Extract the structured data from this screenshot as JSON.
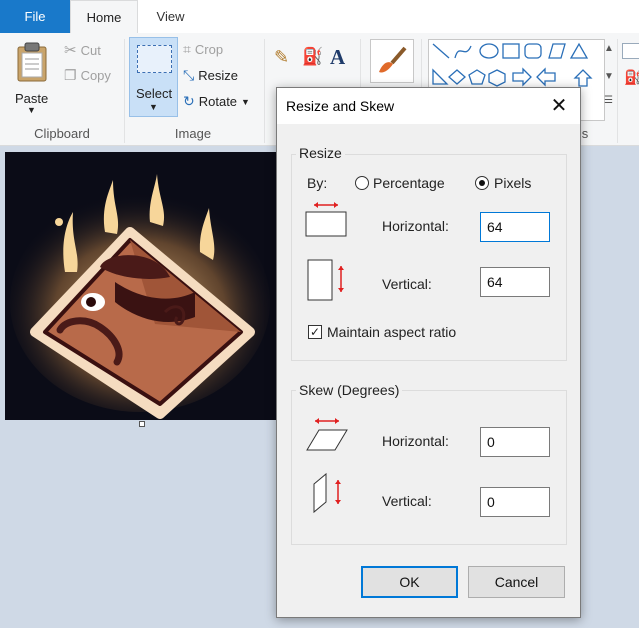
{
  "tabs": {
    "file": "File",
    "home": "Home",
    "view": "View"
  },
  "ribbon": {
    "paste": "Paste",
    "cut": "Cut",
    "copy": "Copy",
    "clipboard_group": "Clipboard",
    "select": "Select",
    "crop": "Crop",
    "resize": "Resize",
    "rotate": "Rotate",
    "image_group": "Image",
    "brushes_letter": "A",
    "shapes_group_partial": "s"
  },
  "dialog": {
    "title": "Resize and Skew",
    "close": "✕",
    "resize_section": "Resize",
    "by_label": "By:",
    "percentage": "Percentage",
    "pixels": "Pixels",
    "horizontal": "Horizontal:",
    "vertical": "Vertical:",
    "resize_horizontal_value": "64",
    "resize_vertical_value": "64",
    "maintain_aspect": "Maintain aspect ratio",
    "skew_section": "Skew (Degrees)",
    "skew_horizontal_value": "0",
    "skew_vertical_value": "0",
    "ok": "OK",
    "cancel": "Cancel"
  },
  "colors": {
    "accent": "#1979ca",
    "focus": "#0078d7",
    "image_bg": "#0b0c17",
    "arrow": "#e02020"
  }
}
